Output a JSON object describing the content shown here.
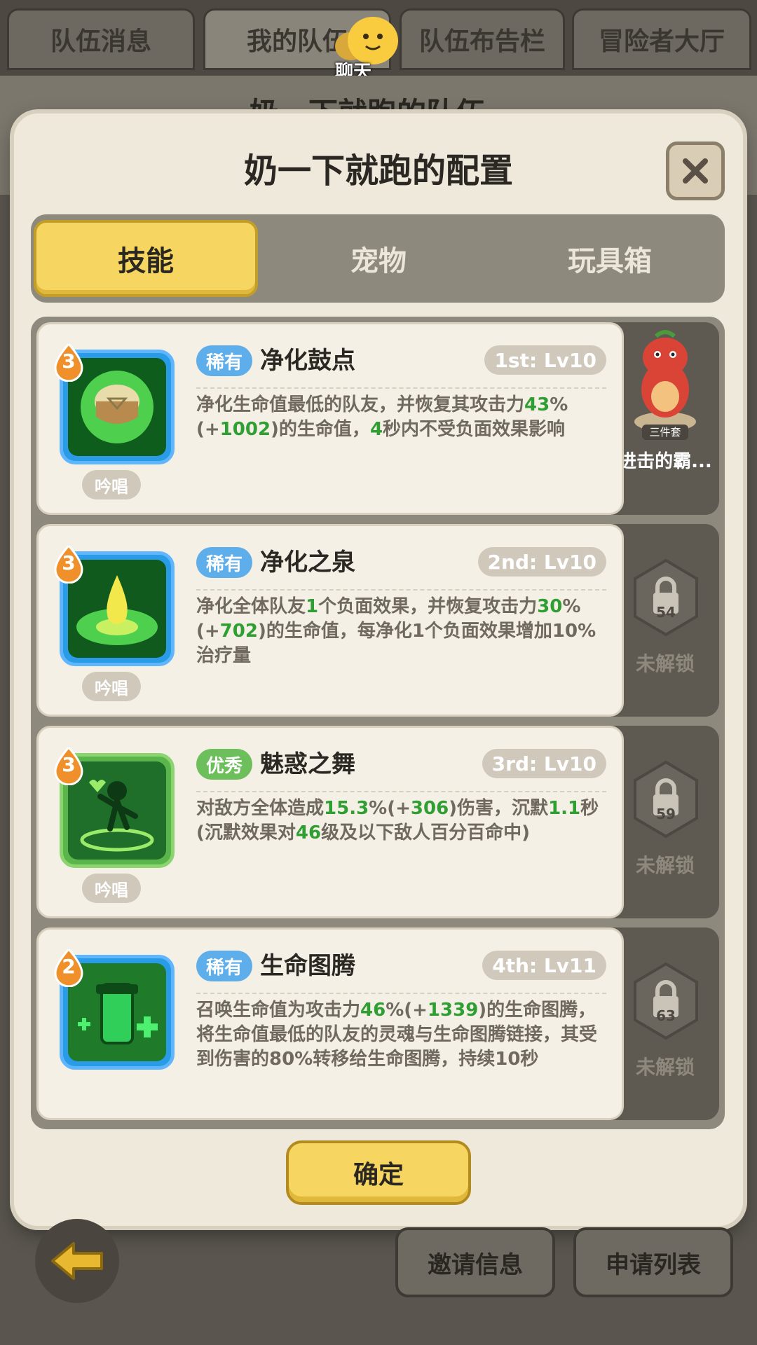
{
  "top_tabs": [
    "队伍消息",
    "我的队伍",
    "队伍布告栏",
    "冒险者大厅"
  ],
  "chat_label": "聊天",
  "background_title": "奶一下就跑的队伍",
  "modal": {
    "title": "奶一下就跑的配置",
    "tabs": [
      "技能",
      "宠物",
      "玩具箱"
    ],
    "confirm_label": "确定"
  },
  "skills": [
    {
      "level": "3",
      "rarity": "稀有",
      "name": "净化鼓点",
      "slot": "1st: Lv10",
      "cast": "吟唱",
      "desc_parts": [
        "净化生命值最低的队友，并恢复其攻击力",
        "43",
        "%(+",
        "1002",
        ")的生命值，",
        "4",
        "秒内不受负面效果影响"
      ],
      "side": {
        "type": "pet",
        "label": "进击的霸...",
        "badge": "三件套"
      }
    },
    {
      "level": "3",
      "rarity": "稀有",
      "name": "净化之泉",
      "slot": "2nd: Lv10",
      "cast": "吟唱",
      "desc_parts": [
        "净化全体队友",
        "1",
        "个负面效果，并恢复攻击力",
        "30",
        "%(+",
        "702",
        ")的生命值，每净化1个负面效果增加10%治疗量"
      ],
      "side": {
        "type": "lock",
        "num": "54",
        "label": "未解锁"
      }
    },
    {
      "level": "3",
      "rarity": "优秀",
      "name": "魅惑之舞",
      "slot": "3rd: Lv10",
      "cast": "吟唱",
      "desc_parts": [
        "对敌方全体造成",
        "15.3",
        "%(+",
        "306",
        ")伤害，沉默",
        "1.1",
        "秒(沉默效果对",
        "46",
        "级及以下敌人百分百命中)"
      ],
      "side": {
        "type": "lock",
        "num": "59",
        "label": "未解锁"
      }
    },
    {
      "level": "2",
      "rarity": "稀有",
      "name": "生命图腾",
      "slot": "4th: Lv11",
      "cast": "",
      "desc_parts": [
        "召唤生命值为攻击力",
        "46",
        "%(+",
        "1339",
        ")的生命图腾，将生命值最低的队友的灵魂与生命图腾链接，其受到伤害的80%转移给生命图腾，持续10秒"
      ],
      "side": {
        "type": "lock",
        "num": "63",
        "label": "未解锁"
      }
    }
  ],
  "bottom_buttons": [
    "邀请信息",
    "申请列表"
  ],
  "colors": {
    "accent_yellow": "#f6d660",
    "rare_blue": "#5daeea",
    "good_green": "#6dbf5c",
    "highlight_green": "#2f9e33"
  }
}
